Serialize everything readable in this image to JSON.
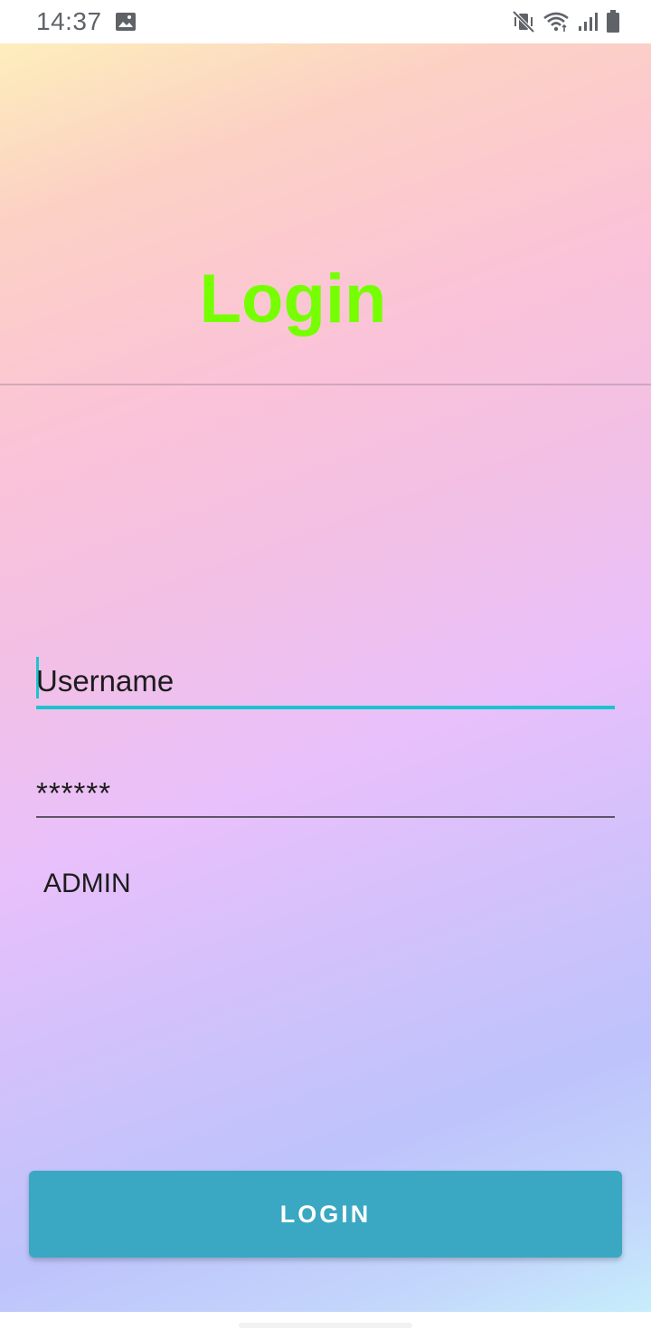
{
  "status_bar": {
    "time": "14:37",
    "icons": [
      "image-icon",
      "vibrate-mute-icon",
      "wifi-icon",
      "signal-icon",
      "battery-icon"
    ]
  },
  "screen": {
    "title": "Login",
    "username_field": {
      "value": "Username"
    },
    "password_field": {
      "value": "******"
    },
    "role_label": "ADMIN",
    "login_button": "LOGIN"
  },
  "colors": {
    "title": "#76ff03",
    "accent": "#1bc4ce",
    "button": "#3aa8c3",
    "gradient_top": "#fdeebc",
    "gradient_mid": "#e8c0fb",
    "gradient_bottom": "#c6eefb"
  }
}
